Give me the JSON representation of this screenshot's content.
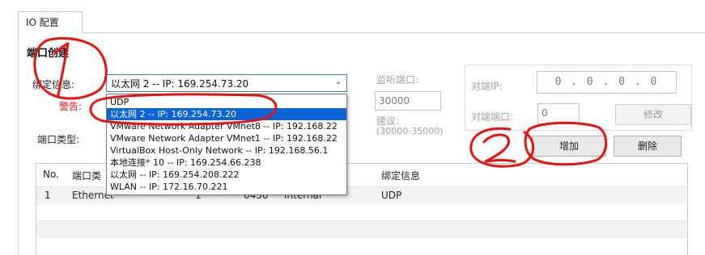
{
  "tabs": [
    {
      "label": "IO 配置"
    }
  ],
  "section": {
    "title": "端口创建"
  },
  "bind_info": {
    "label": "绑定信息:",
    "selected": "以太网 2 -- IP: 169.254.73.20",
    "warning": "警告:",
    "options": [
      "UDP",
      "以太网 2 -- IP: 169.254.73.20",
      "VMware Network Adapter VMnet8 -- IP: 192.168.22",
      "VMware Network Adapter VMnet1 -- IP: 192.168.22",
      "VirtualBox Host-Only Network -- IP: 192.168.56.1",
      "本地连接* 10 -- IP: 169.254.66.238",
      "以太网 -- IP: 169.254.208.222",
      "WLAN -- IP: 172.16.70.221"
    ],
    "selected_index": 1
  },
  "port_type": {
    "label": "端口类型:"
  },
  "listen": {
    "label": "监听端口:",
    "value": "30000",
    "hint_label": "建议:",
    "hint_range": "(30000-35000)"
  },
  "peer": {
    "ip_label": "对端IP:",
    "ip_value": "0 . 0 . 0 . 0",
    "port_label": "对端端口:",
    "port_value": "0",
    "modify_button": "修改"
  },
  "actions": {
    "add_button": "增加",
    "delete_button": "删除"
  },
  "table": {
    "columns": [
      "No.",
      "端口类",
      "",
      "",
      "态",
      "绑定信息"
    ],
    "rows": [
      {
        "no": "1",
        "type": "Ethernet",
        "c3": "1",
        "c4": "0430",
        "status": "Internal",
        "binding": "UDP"
      }
    ]
  },
  "annotations": {
    "mark1": "1",
    "mark2": "2",
    "color": "#e81010"
  },
  "colors": {
    "selection": "#0a64d8",
    "focus_border": "#3c7fb1"
  }
}
